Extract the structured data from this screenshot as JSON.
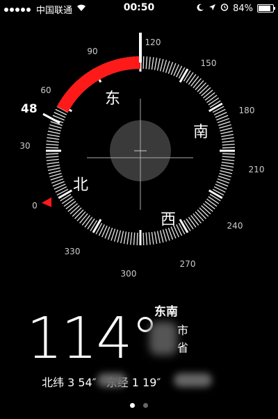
{
  "status_bar": {
    "carrier": "中国联通",
    "time": "00:50",
    "battery": "84%",
    "icons": [
      "signal-dots-icon",
      "wifi-icon",
      "moon-icon",
      "location-arrow-icon",
      "alarm-icon",
      "battery-icon"
    ]
  },
  "compass": {
    "heading_value": 114,
    "bearing_marker": "48",
    "cardinal": {
      "east": "东",
      "south": "南",
      "west": "西",
      "north": "北"
    },
    "degree_labels": [
      "0",
      "30",
      "60",
      "90",
      "120",
      "150",
      "180",
      "210",
      "240",
      "270",
      "300",
      "330"
    ],
    "highlight_color": "#ff1a1a"
  },
  "reading": {
    "degrees": "114°",
    "direction": "东南",
    "city_suffix": "市",
    "province_suffix": "省",
    "latitude": "北纬 3     54″",
    "longitude": "东经 1      19″"
  },
  "pager": {
    "count": 2,
    "active": 0
  }
}
